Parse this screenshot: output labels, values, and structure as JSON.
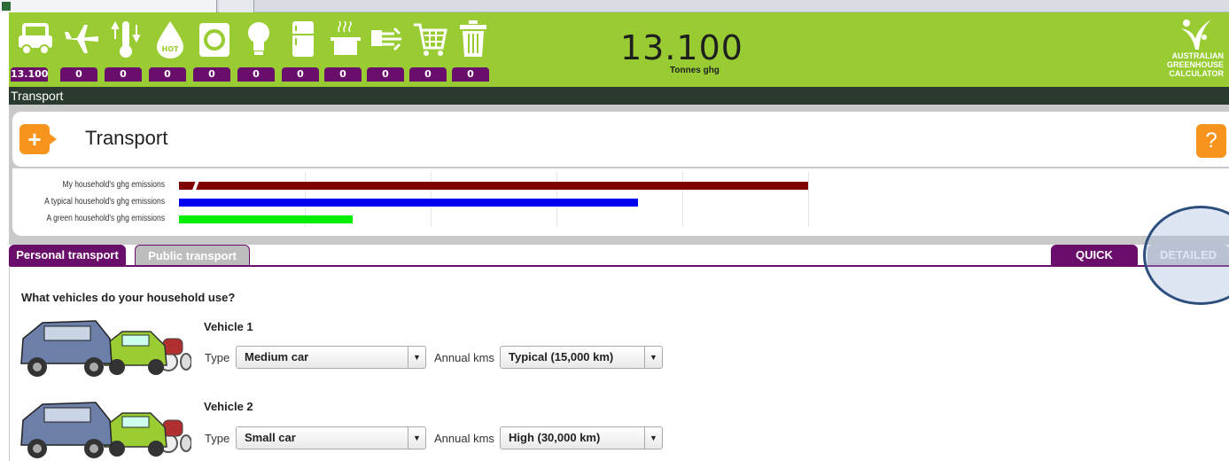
{
  "browser": {
    "tab_title": ""
  },
  "header": {
    "icons": [
      {
        "icon": "transport-icon",
        "count": "13.100"
      },
      {
        "icon": "plane-icon",
        "count": "0"
      },
      {
        "icon": "thermometer-icon",
        "count": "0"
      },
      {
        "icon": "hot-water-icon",
        "count": "0"
      },
      {
        "icon": "washing-machine-icon",
        "count": "0"
      },
      {
        "icon": "lightbulb-icon",
        "count": "0"
      },
      {
        "icon": "fridge-icon",
        "count": "0"
      },
      {
        "icon": "cooking-pot-icon",
        "count": "0"
      },
      {
        "icon": "power-plug-icon",
        "count": "0"
      },
      {
        "icon": "shopping-cart-icon",
        "count": "0"
      },
      {
        "icon": "rubbish-bin-icon",
        "count": "0"
      }
    ],
    "total_value": "13.100",
    "total_unit": "Tonnes ghg",
    "logo_lines": [
      "AUSTRALIAN",
      "GREENHOUSE",
      "CALCULATOR"
    ]
  },
  "section_bar": {
    "label": "Transport"
  },
  "panel": {
    "title": "Transport",
    "add_label": "+",
    "help_label": "?"
  },
  "chart_data": {
    "type": "bar",
    "categories": [
      "My household's ghg emissions",
      "A typical household's ghg emissions",
      "A green household's ghg emissions"
    ],
    "values": [
      710,
      518,
      196
    ],
    "colors": [
      "#800000",
      "#0000ee",
      "#00ee00"
    ],
    "grid": true
  },
  "tabs": {
    "personal": "Personal transport",
    "public": "Public transport",
    "quick": "QUICK",
    "detailed": "DETAILED"
  },
  "form": {
    "question": "What vehicles do your household use?",
    "vehicles": [
      {
        "title": "Vehicle 1",
        "type_label": "Type",
        "type_value": "Medium car",
        "kms_label": "Annual kms",
        "kms_value": "Typical (15,000 km)"
      },
      {
        "title": "Vehicle 2",
        "type_label": "Type",
        "type_value": "Small car",
        "kms_label": "Annual kms",
        "kms_value": "High (30,000 km)"
      }
    ]
  }
}
